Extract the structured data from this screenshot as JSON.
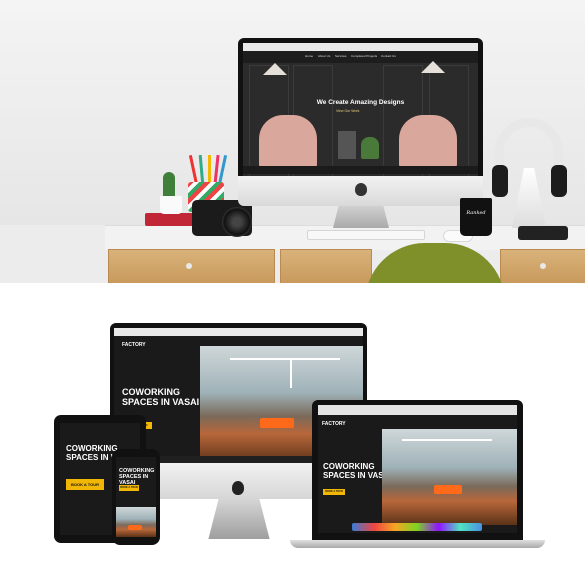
{
  "top_scene": {
    "website": {
      "nav_items": [
        "Home",
        "About Us",
        "Services",
        "Completed Projects",
        "Contact Us"
      ],
      "headline": "We Create Amazing Designs",
      "cta": "View Our Work"
    },
    "mug_text": "Ranked"
  },
  "bottom_scene": {
    "site": {
      "logo": "FACTORY",
      "headline_line1": "COWORKING",
      "headline_line2": "SPACES IN VASAI",
      "cta": "BOOK A TOUR"
    }
  },
  "colors": {
    "accent_yellow": "#f2b705",
    "desk_wood": "#c8995c",
    "chair_green": "#7f8f2a"
  }
}
